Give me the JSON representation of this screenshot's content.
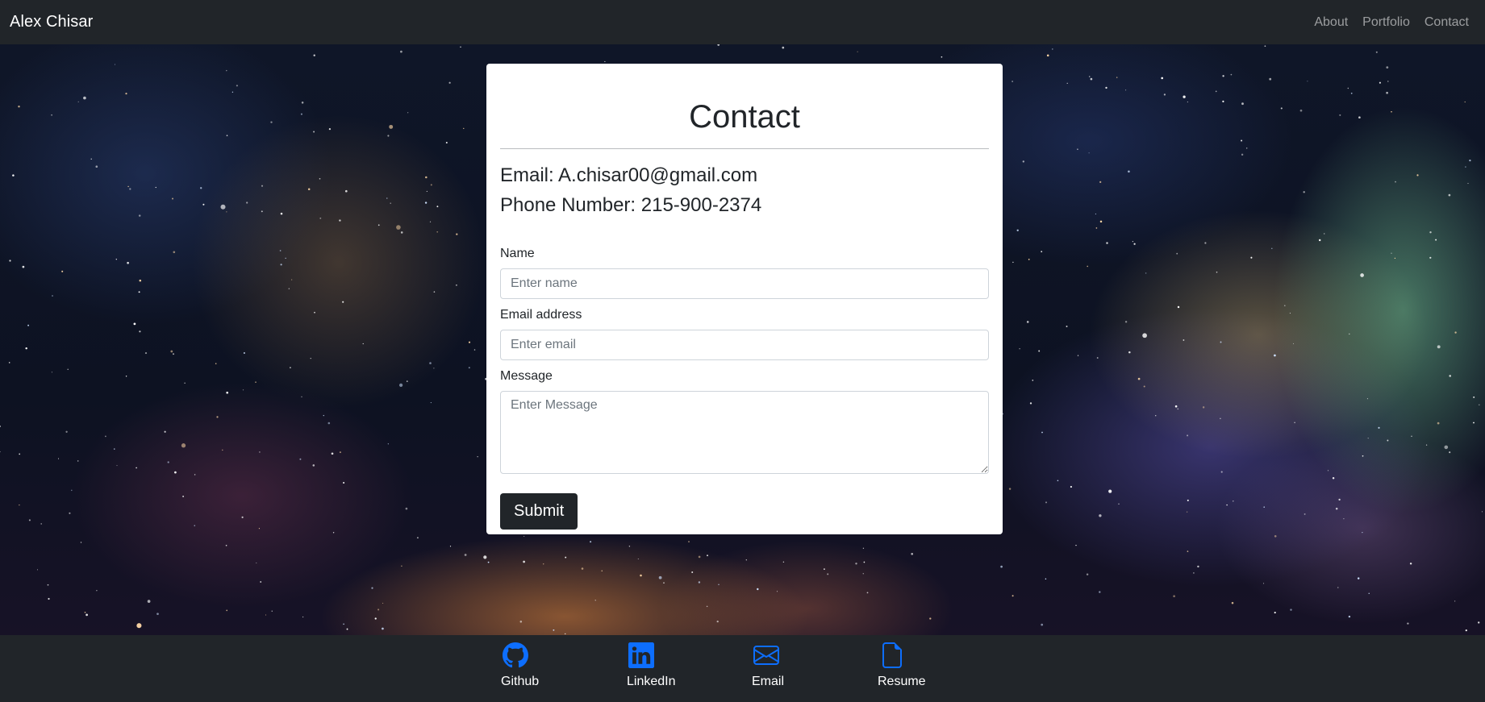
{
  "navbar": {
    "brand": "Alex Chisar",
    "links": [
      "About",
      "Portfolio",
      "Contact"
    ]
  },
  "contact": {
    "title": "Contact",
    "email_line": "Email: A.chisar00@gmail.com",
    "phone_line": "Phone Number: 215-900-2374",
    "form": {
      "name_label": "Name",
      "name_placeholder": "Enter name",
      "email_label": "Email address",
      "email_placeholder": "Enter email",
      "message_label": "Message",
      "message_placeholder": "Enter Message",
      "submit_label": "Submit"
    }
  },
  "footer": {
    "items": [
      {
        "label": "Github",
        "icon": "github-icon"
      },
      {
        "label": "LinkedIn",
        "icon": "linkedin-icon"
      },
      {
        "label": "Email",
        "icon": "envelope-icon"
      },
      {
        "label": "Resume",
        "icon": "file-icon"
      }
    ]
  },
  "colors": {
    "navbar_bg": "#212529",
    "footer_icon": "#0d6efd",
    "button_bg": "#212529"
  }
}
